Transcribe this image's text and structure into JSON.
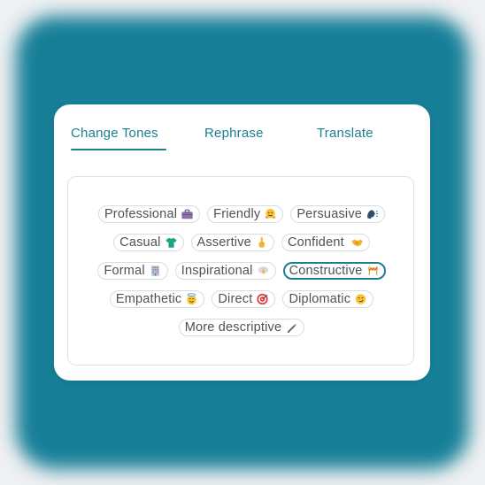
{
  "tabs": [
    {
      "label": "Change Tones",
      "active": true
    },
    {
      "label": "Rephrase",
      "active": false
    },
    {
      "label": "Translate",
      "active": false
    }
  ],
  "tones": [
    {
      "label": "Professional",
      "icon": "briefcase-icon"
    },
    {
      "label": "Friendly",
      "icon": "hugging-face-icon"
    },
    {
      "label": "Persuasive",
      "icon": "speaking-head-icon"
    },
    {
      "label": "Casual",
      "icon": "tshirt-icon"
    },
    {
      "label": "Assertive",
      "icon": "pointing-finger-icon"
    },
    {
      "label": "Confident",
      "icon": "handshake-icon"
    },
    {
      "label": "Formal",
      "icon": "office-building-icon"
    },
    {
      "label": "Inspirational",
      "icon": "lightning-cloud-icon"
    },
    {
      "label": "Constructive",
      "icon": "construction-icon",
      "selected": true
    },
    {
      "label": "Empathetic",
      "icon": "smiling-halo-icon"
    },
    {
      "label": "Direct",
      "icon": "target-icon"
    },
    {
      "label": "Diplomatic",
      "icon": "smirk-face-icon"
    },
    {
      "label": "More descriptive",
      "icon": "pencil-icon"
    }
  ],
  "colors": {
    "accent": "#1b7f91",
    "background": "#167f97",
    "chip_border": "#d9dcdf",
    "text": "#4e5156"
  }
}
